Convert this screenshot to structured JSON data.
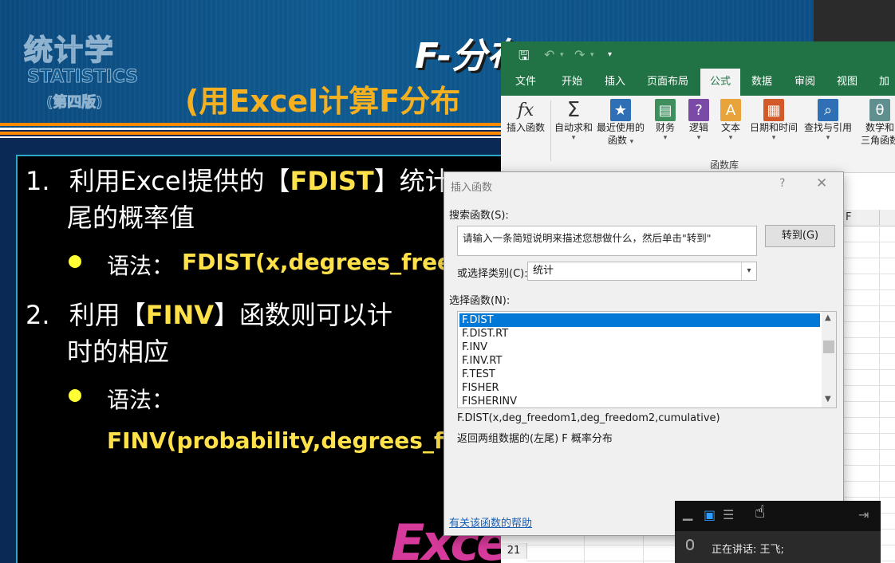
{
  "slide": {
    "logo_cn": "统计学",
    "logo_en": "STATISTICS",
    "logo_edition": "(第四版)",
    "title": "F-分布",
    "subtitle": "(用Excel计算F分布",
    "item1_num": "1.",
    "item1_pre": "利用Excel提供的【",
    "item1_fn": "FDIST",
    "item1_post": "】统计",
    "item1_line2": "尾的概率值",
    "syntax_label": "语法：",
    "item1_code": "FDIST(x,degrees_freed",
    "item2_num": "2.",
    "item2_pre": "利用【",
    "item2_fn": "FINV",
    "item2_post": "】函数则可以计",
    "item2_line2": "时的相应",
    "item2_code": "FINV(probability,degrees_fre",
    "excel_logo": "Exce"
  },
  "excel": {
    "tabs": [
      "文件",
      "开始",
      "插入",
      "页面布局",
      "公式",
      "数据",
      "审阅",
      "视图",
      "加"
    ],
    "active_tab": "公式",
    "ribbon_buttons": [
      {
        "label": "插入函数",
        "icon": "fx-icon",
        "glyph": "fx",
        "color": "#ffffff"
      },
      {
        "label": "自动求和",
        "icon": "sum-icon",
        "glyph": "Σ",
        "color": "#ffffff"
      },
      {
        "label": "最近使用的",
        "label2": "函数",
        "icon": "recent-star-icon",
        "glyph": "★",
        "color": "#2f6fb5"
      },
      {
        "label": "财务",
        "icon": "finance-icon",
        "glyph": "▤",
        "color": "#3f8f5e"
      },
      {
        "label": "逻辑",
        "icon": "logic-icon",
        "glyph": "?",
        "color": "#7a4aa6"
      },
      {
        "label": "文本",
        "icon": "text-icon",
        "glyph": "A",
        "color": "#e8a33a"
      },
      {
        "label": "日期和时间",
        "icon": "calendar-icon",
        "glyph": "▦",
        "color": "#d25a2a"
      },
      {
        "label": "查找与引用",
        "icon": "lookup-icon",
        "glyph": "⌕",
        "color": "#2f6fb5"
      },
      {
        "label": "数学和",
        "label2": "三角函数",
        "icon": "theta-icon",
        "glyph": "θ",
        "color": "#5f8f8f"
      }
    ],
    "group_label": "函数库",
    "column_header_f": "F",
    "row_number": "21"
  },
  "dialog": {
    "title": "插入函数",
    "help_glyph": "?",
    "search_label": "搜索函数(S):",
    "search_value": "请输入一条简短说明来描述您想做什么，然后单击\"转到\"",
    "go_button": "转到(G)",
    "category_label": "或选择类别(C):",
    "category_value": "统计",
    "functions_label": "选择函数(N):",
    "functions": [
      "F.DIST",
      "F.DIST.RT",
      "F.INV",
      "F.INV.RT",
      "F.TEST",
      "FISHER",
      "FISHERINV"
    ],
    "selected_function": "F.DIST",
    "signature": "F.DIST(x,deg_freedom1,deg_freedom2,cumulative)",
    "description": "返回两组数据的(左尾) F 概率分布",
    "help_link": "有关该函数的帮助"
  },
  "meeting": {
    "speaking_text": "正在讲话: 王飞;"
  }
}
